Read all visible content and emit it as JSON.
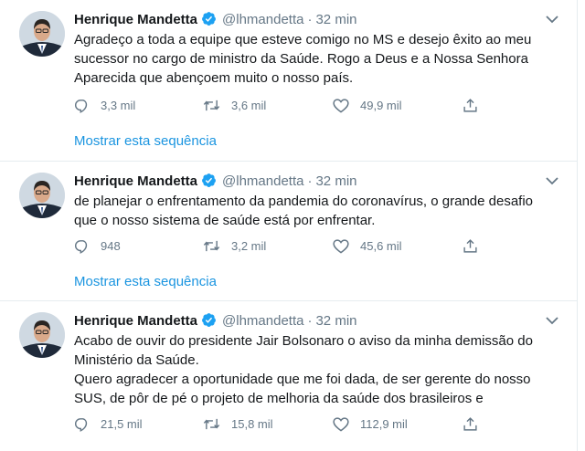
{
  "tweets": [
    {
      "author_name": "Henrique Mandetta",
      "handle": "@lhmandetta",
      "separator": "·",
      "time": "32 min",
      "lines": [
        "Agradeço a toda a equipe que esteve comigo no MS e desejo êxito ao meu",
        "sucessor no cargo de ministro da Saúde. Rogo a Deus e a Nossa Senhora",
        "Aparecida que abençoem muito o nosso país."
      ],
      "replies": "3,3 mil",
      "retweets": "3,6 mil",
      "likes": "49,9 mil",
      "thread_link": "Mostrar esta sequência"
    },
    {
      "author_name": "Henrique Mandetta",
      "handle": "@lhmandetta",
      "separator": "·",
      "time": "32 min",
      "lines": [
        "de planejar o enfrentamento da pandemia do coronavírus, o grande desafio",
        "que o nosso sistema de saúde está por enfrentar."
      ],
      "replies": "948",
      "retweets": "3,2 mil",
      "likes": "45,6 mil",
      "thread_link": "Mostrar esta sequência"
    },
    {
      "author_name": "Henrique Mandetta",
      "handle": "@lhmandetta",
      "separator": "·",
      "time": "32 min",
      "lines": [
        "Acabo de ouvir do presidente Jair Bolsonaro o aviso da minha demissão do",
        "Ministério da Saúde.",
        "Quero agradecer a oportunidade que me foi dada, de ser gerente do nosso",
        "SUS, de pôr de pé o projeto de melhoria da saúde dos brasileiros e"
      ],
      "replies": "21,5 mil",
      "retweets": "15,8 mil",
      "likes": "112,9 mil"
    }
  ],
  "icons": {
    "verified": "verified-badge-icon",
    "caret": "chevron-down-icon",
    "reply": "reply-icon",
    "retweet": "retweet-icon",
    "like": "heart-icon",
    "share": "share-icon"
  },
  "colors": {
    "link": "#1b95e0",
    "verified": "#1da1f2",
    "secondary_text": "#657786",
    "divider": "#e6ecf0"
  }
}
